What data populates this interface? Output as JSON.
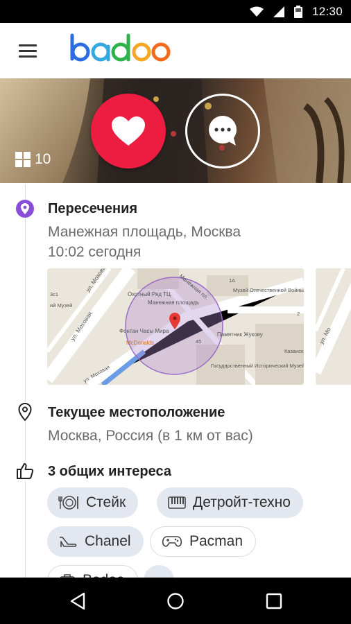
{
  "status_bar": {
    "time": "12:30"
  },
  "app": {
    "logo_text": "badoo"
  },
  "hero": {
    "photo_count": "10"
  },
  "encounter": {
    "title": "Пересечения",
    "location": "Манежная площадь, Москва",
    "time": "10:02 сегодня"
  },
  "map": {
    "labels": {
      "street1": "ул. Моховая",
      "street2": "ул. Моховая",
      "mall": "Охотный Ряд ТЦ",
      "square": "Манежная площадь",
      "street3": "Манежная пл.",
      "museum1": "Музей Отечественной Войны 1812 Года",
      "fountain": "Фонтан Часы Мира",
      "mcdonalds": "McDonalds",
      "monument": "Памятник Жукову",
      "museum2": "Государственный Исторический Музей",
      "kazan": "Казанск Красн",
      "num1": "3с1",
      "num2": "1А",
      "num3": "45",
      "num4": "2",
      "small1": "ий Музей",
      "street4": "ул. Моховая",
      "street5": "ул. Мо"
    }
  },
  "current_location": {
    "title": "Текущее местоположение",
    "value": "Москва, Россия (в 1 км от вас)"
  },
  "interests": {
    "title": "3 общих интереса",
    "chips": [
      {
        "label": "Стейк",
        "icon": "plate-icon"
      },
      {
        "label": "Детройт-техно",
        "icon": "keyboard-icon"
      },
      {
        "label": "Chanel",
        "icon": "heel-icon"
      },
      {
        "label": "Pacman",
        "icon": "gamepad-icon"
      },
      {
        "label": "Badoo",
        "icon": "bag-icon"
      }
    ]
  },
  "colors": {
    "accent_red": "#ec1d41",
    "location_purple": "#8a4fd8",
    "chip_fill": "#e3e8f0"
  }
}
